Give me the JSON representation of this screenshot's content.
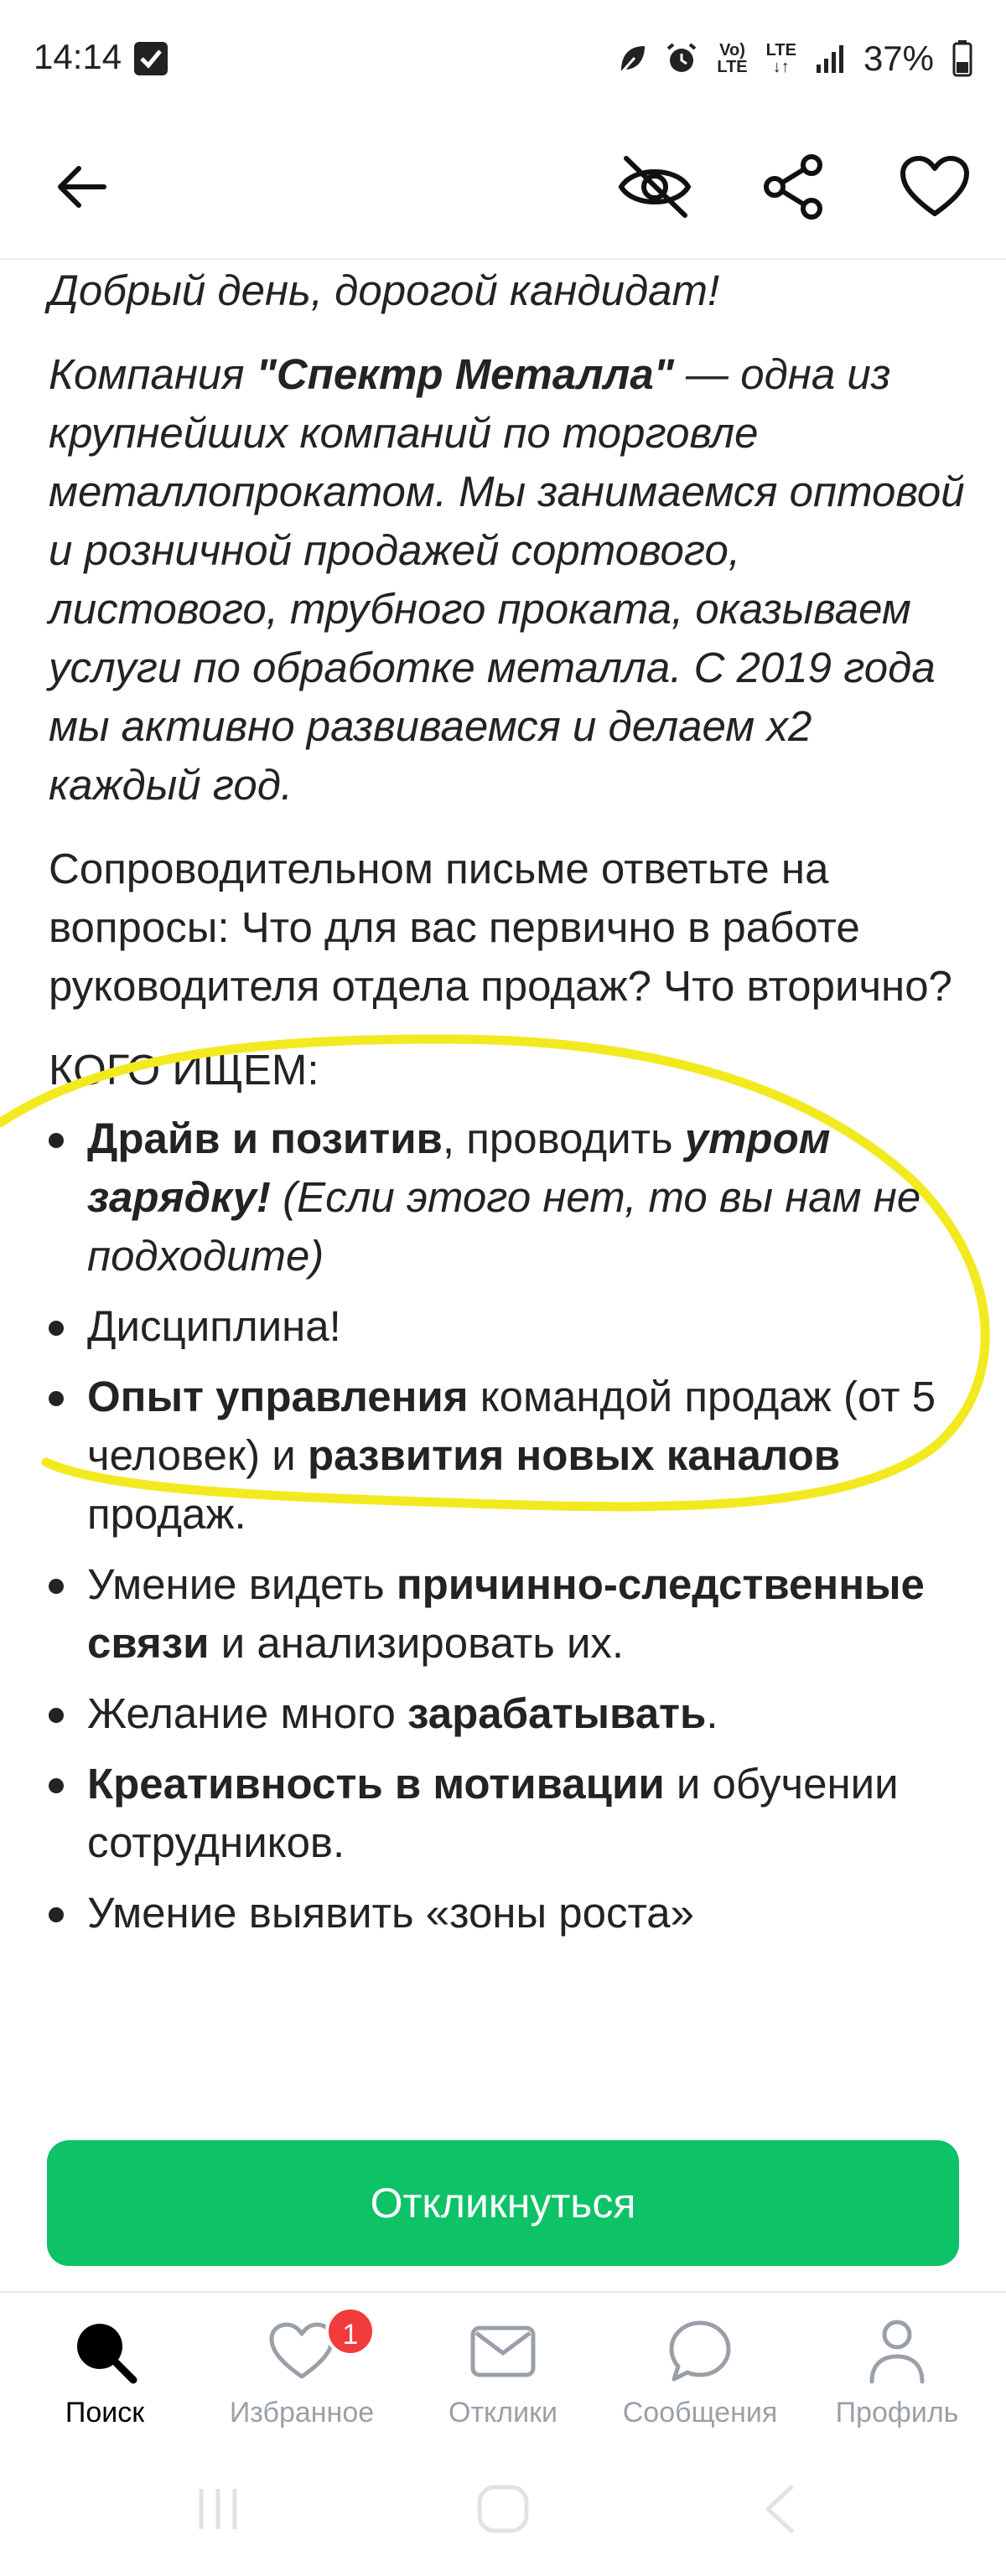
{
  "status_bar": {
    "time": "14:14",
    "volte_top": "Vo)",
    "volte_bottom": "LTE",
    "lte_top": "LTE",
    "lte_bottom": "↓↑",
    "battery": "37%"
  },
  "toolbar": {
    "back_icon": "arrow-left-icon",
    "hide_icon": "eye-off-icon",
    "share_icon": "share-icon",
    "favorite_icon": "heart-icon"
  },
  "content": {
    "greeting": "Добрый день, дорогой кандидат!",
    "company_intro_prefix": "Компания ",
    "company_name": "\"Спектр Металла\"",
    "company_intro_text": " — одна из крупнейших компаний по торговле металлопрокатом. Мы занимаемся оптовой и розничной продажей сортового, листового, трубного проката, оказываем услуги по обработке металла. С 2019 года мы активно развиваемся и делаем x2 каждый год.",
    "cover_letter": "Сопроводительном письме ответьте на вопросы: Что для вас первично в работе руководителя отдела продаж? Что вторично?",
    "looking_for_heading": "КОГО ИЩЕМ:",
    "req1_bold": "Драйв и позитив",
    "req1_text": ", проводить ",
    "req1_bold_italic": "утром зарядку!",
    "req1_italic": " (Если этого нет, то вы нам не подходите)",
    "req2": "Дисциплина!",
    "req3_bold1": "Опыт управления",
    "req3_text1": " командой продаж (от 5 человек) и ",
    "req3_bold2": "развития новых каналов",
    "req3_text2": " продаж.",
    "req4_text1": "Умение видеть ",
    "req4_bold": "причинно-следственные связи",
    "req4_text2": " и анализировать их.",
    "req5_text1": "Желание много ",
    "req5_bold": "зарабатывать",
    "req5_text2": ".",
    "req6_bold": "Креативность в мотивации",
    "req6_text": " и обучении сотрудников.",
    "req7": "Умение выявить «зоны роста»"
  },
  "apply_button": {
    "label": "Откликнуться"
  },
  "bottom_nav": {
    "items": [
      {
        "label": "Поиск",
        "icon": "search-icon",
        "active": true
      },
      {
        "label": "Избранное",
        "icon": "heart-icon",
        "badge": "1"
      },
      {
        "label": "Отклики",
        "icon": "envelope-icon"
      },
      {
        "label": "Сообщения",
        "icon": "chat-bubble-icon"
      },
      {
        "label": "Профиль",
        "icon": "user-icon"
      }
    ]
  },
  "colors": {
    "accent_green": "#0dc267",
    "badge_red": "#f23b3b",
    "annotation_yellow": "#f2ea1f",
    "text_dark": "#232325",
    "nav_inactive": "#9aa0a8"
  }
}
